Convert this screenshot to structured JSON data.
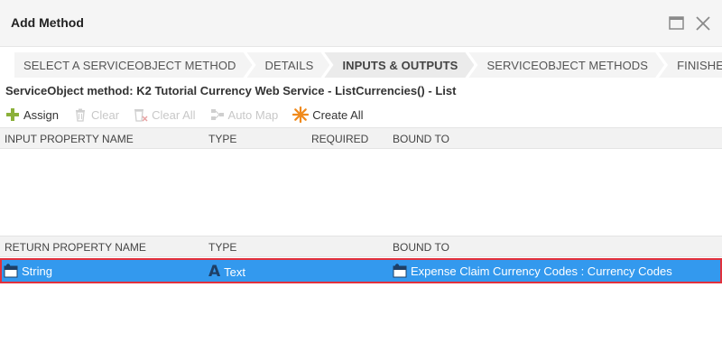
{
  "window": {
    "title": "Add Method"
  },
  "wizard": {
    "steps": [
      {
        "label": "SELECT A SERVICEOBJECT METHOD",
        "active": false
      },
      {
        "label": "DETAILS",
        "active": false
      },
      {
        "label": "INPUTS & OUTPUTS",
        "active": true
      },
      {
        "label": "SERVICEOBJECT METHODS",
        "active": false
      },
      {
        "label": "FINISHED",
        "active": false
      }
    ]
  },
  "service_object_label": "ServiceObject method: K2 Tutorial Currency Web Service - ListCurrencies() - List",
  "toolbar": {
    "assign": {
      "label": "Assign",
      "icon": "plus-icon",
      "enabled": true
    },
    "clear": {
      "label": "Clear",
      "icon": "trash-icon",
      "enabled": false
    },
    "clear_all": {
      "label": "Clear All",
      "icon": "clear-all-icon",
      "enabled": false
    },
    "auto_map": {
      "label": "Auto Map",
      "icon": "auto-map-icon",
      "enabled": false
    },
    "create_all": {
      "label": "Create All",
      "icon": "starburst-icon",
      "enabled": true
    }
  },
  "inputs_table": {
    "columns": [
      "INPUT PROPERTY NAME",
      "TYPE",
      "REQUIRED",
      "BOUND TO"
    ],
    "rows": []
  },
  "returns_table": {
    "columns": [
      "RETURN PROPERTY NAME",
      "TYPE",
      "BOUND TO"
    ],
    "rows": [
      {
        "name": "String",
        "name_icon": "property-icon",
        "type": "Text",
        "type_icon": "text-type-icon",
        "bound_to": "Expense Claim Currency Codes : Currency Codes",
        "bound_icon": "property-icon",
        "selected": true
      }
    ]
  },
  "colors": {
    "selected_row": "#3399ee",
    "selected_row_border": "#e2313c",
    "assign_icon": "#8bb03a",
    "create_all_icon": "#f08a1c"
  }
}
